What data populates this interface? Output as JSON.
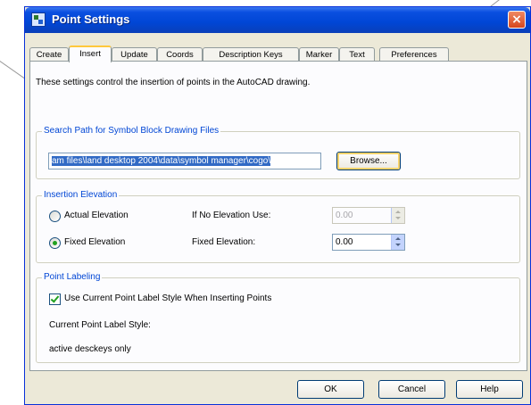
{
  "window": {
    "title": "Point Settings",
    "close_glyph": "×",
    "icon": "point-settings-app-icon"
  },
  "tabs": [
    {
      "label": "Create",
      "active": false
    },
    {
      "label": "Insert",
      "active": true
    },
    {
      "label": "Update",
      "active": false
    },
    {
      "label": "Coords",
      "active": false
    },
    {
      "label": "Description Keys",
      "active": false
    },
    {
      "label": "Marker",
      "active": false
    },
    {
      "label": "Text",
      "active": false
    },
    {
      "label": "Preferences",
      "active": false
    }
  ],
  "insert": {
    "description": "These settings control the insertion of points in the AutoCAD drawing.",
    "search_path": {
      "group_title": "Search Path for Symbol Block Drawing Files",
      "path_value": "am files\\land desktop 2004\\data\\symbol manager\\cogo\\",
      "browse_label": "Browse..."
    },
    "insertion_elevation": {
      "group_title": "Insertion Elevation",
      "actual_elevation_label": "Actual Elevation",
      "actual_elevation_selected": false,
      "fixed_elevation_label": "Fixed Elevation",
      "fixed_elevation_selected": true,
      "no_elevation_use_label": "If No Elevation Use:",
      "no_elevation_use_value": "0.00",
      "fixed_elevation_field_label": "Fixed Elevation:",
      "fixed_elevation_value": "0.00"
    },
    "point_labeling": {
      "group_title": "Point Labeling",
      "use_current_style_label": "Use Current Point Label Style When Inserting Points",
      "use_current_style_checked": true,
      "current_style_label": "Current Point Label Style:",
      "current_style_value": "active desckeys only"
    }
  },
  "buttons": {
    "ok": "OK",
    "cancel": "Cancel",
    "help": "Help"
  },
  "colors": {
    "titlebar": "#0046d5",
    "dialog_bg": "#ece9d8",
    "group_title": "#0046d5",
    "selection": "#316ac5",
    "close_button": "#d6461d"
  }
}
